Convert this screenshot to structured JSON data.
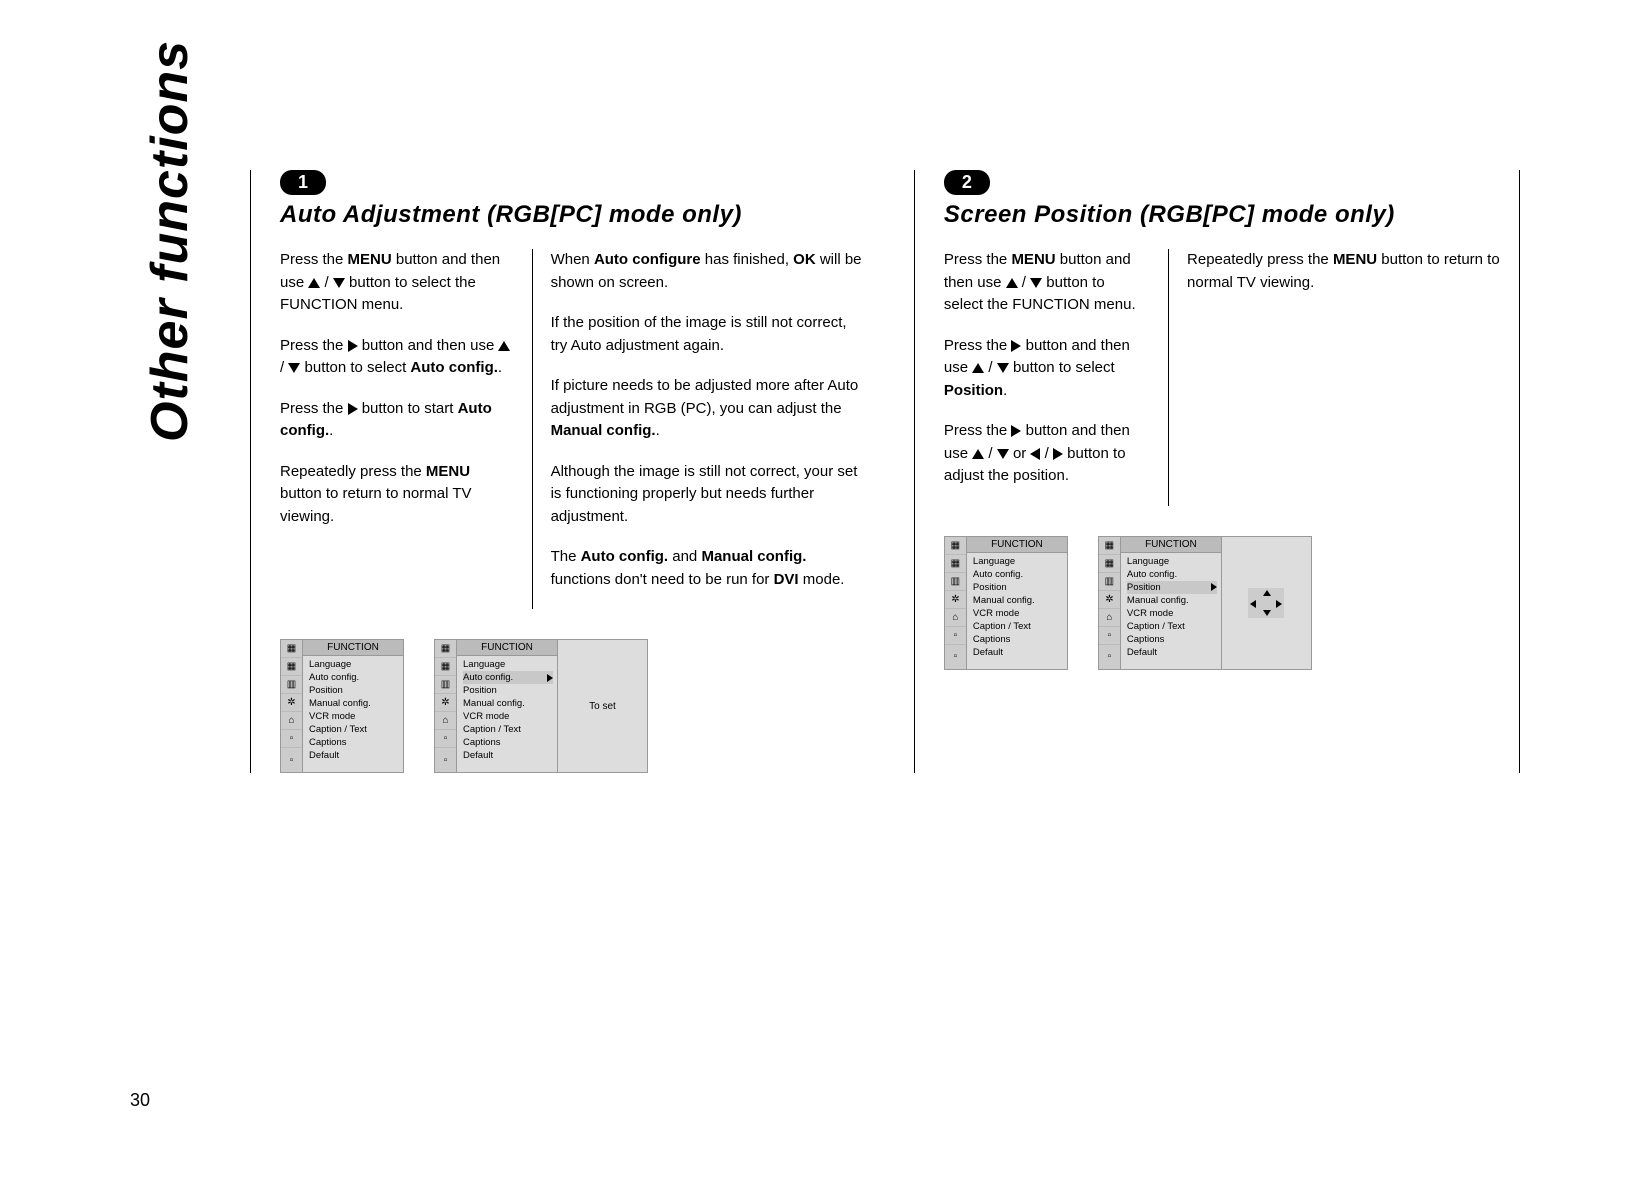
{
  "pageNumber": "30",
  "sidebarTitle": "Other functions",
  "section1": {
    "badge": "1",
    "title": "Auto Adjustment (RGB[PC] mode only)",
    "leftParas": {
      "p1a": "Press the ",
      "p1b": "MENU",
      "p1c": " button and then use ",
      "p1d": " / ",
      "p1e": " button to select the FUNCTION menu.",
      "p2a": "Press the ",
      "p2b": " button and then use ",
      "p2c": " / ",
      "p2d": " button to select ",
      "p2e": "Auto config.",
      "p2f": ".",
      "p3a": "Press the ",
      "p3b": " button to start ",
      "p3c": "Auto config.",
      "p3d": ".",
      "p4a": "Repeatedly press the ",
      "p4b": "MENU",
      "p4c": " button to return to normal TV viewing."
    },
    "rightParas": {
      "r1a": "When ",
      "r1b": "Auto configure",
      "r1c": " has finished, ",
      "r1d": "OK",
      "r1e": " will be shown on screen.",
      "r2": "If the position of the image is still not correct, try Auto adjustment again.",
      "r3a": "If picture needs to be adjusted more after Auto adjustment in RGB (PC), you can adjust the ",
      "r3b": "Manual config.",
      "r3c": ".",
      "r4": "Although the image is still not correct, your set is functioning properly but needs further adjustment.",
      "r5a": "The ",
      "r5b": "Auto config.",
      "r5c": " and ",
      "r5d": "Manual config.",
      "r5e": " functions don't need to be run for ",
      "r5f": "DVI",
      "r5g": " mode."
    }
  },
  "section2": {
    "badge": "2",
    "title": "Screen Position (RGB[PC] mode only)",
    "leftParas": {
      "p1a": "Press the ",
      "p1b": "MENU",
      "p1c": " button and then use ",
      "p1d": " / ",
      "p1e": " button to select the FUNCTION menu.",
      "p2a": "Press the ",
      "p2b": " button and then use ",
      "p2c": " / ",
      "p2d": " button to select ",
      "p2e": "Position",
      "p2f": ".",
      "p3a": "Press the ",
      "p3b": " button and then use ",
      "p3c": " / ",
      "p3d": " or ",
      "p3e": " / ",
      "p3f": " button to adjust the position."
    },
    "rightParas": {
      "r1a": "Repeatedly press the ",
      "r1b": "MENU",
      "r1c": " button to return to normal TV viewing."
    }
  },
  "osd": {
    "header": "FUNCTION",
    "items": [
      "Language",
      "Auto config.",
      "Position",
      "Manual config.",
      "VCR mode",
      "Caption / Text",
      "Captions",
      "Default"
    ],
    "toSet": "To set"
  }
}
